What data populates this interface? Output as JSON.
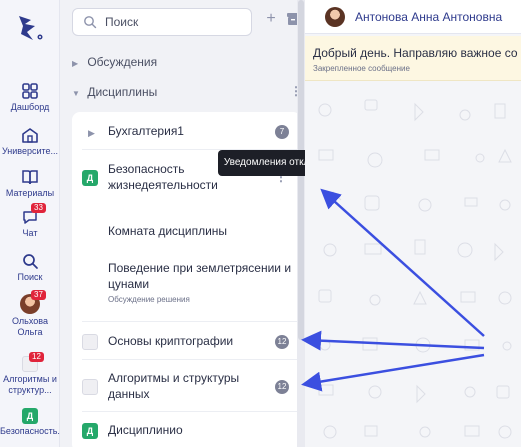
{
  "rail": {
    "items": [
      {
        "label": "Дашборд"
      },
      {
        "label": "Университе..."
      },
      {
        "label": "Материалы"
      },
      {
        "label": "Чат",
        "badge": "33"
      },
      {
        "label": "Поиск"
      },
      {
        "label": "Ольхова Ольга",
        "badge": "37"
      },
      {
        "label": "Алгоритмы и структур...",
        "badge": "12"
      },
      {
        "label": "Безопасность...",
        "square": "Д"
      }
    ]
  },
  "panel": {
    "search_placeholder": "Поиск",
    "sections": [
      {
        "label": "Обсуждения"
      },
      {
        "label": "Дисциплины"
      }
    ],
    "rows": [
      {
        "label": "Бухгалтерия1",
        "count": "7"
      },
      {
        "label_line1": "Безопасность",
        "label_line2": "жизнедеятельности",
        "square": "Д"
      },
      {
        "label": "Комната дисциплины"
      },
      {
        "label_line1": "Поведение при землетрясении и",
        "label_line2": "цунами",
        "sub": "Обсуждение решения"
      },
      {
        "label": "Основы криптографии",
        "count": "12"
      },
      {
        "label_line1": "Алгоритмы и структуры",
        "label_line2": "данных",
        "count": "12"
      },
      {
        "label": "Дисциплинио",
        "square": "Д"
      }
    ],
    "tooltip": "Уведомления отключены"
  },
  "chat": {
    "name": "Антонова Анна Антоновна",
    "pinned_text": "Добрый день. Направляю важное со",
    "pinned_sub": "Закрепленное сообщение"
  },
  "colors": {
    "accent": "#2e3a8c",
    "badge": "#e0243b",
    "green": "#25a86a",
    "arrow": "#3b4fe0"
  }
}
